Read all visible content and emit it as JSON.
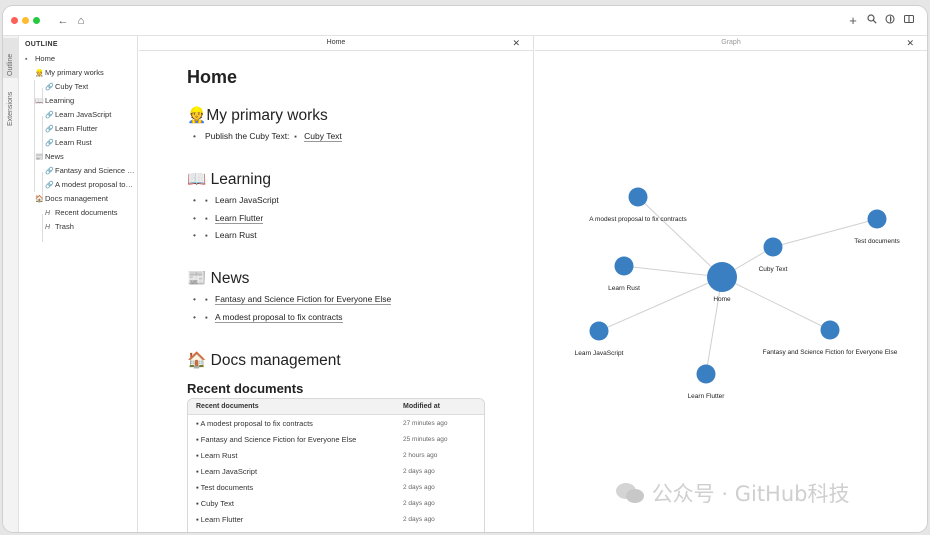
{
  "titlebar": {
    "colors": {
      "close": "#fe5f57",
      "minimize": "#febc2e",
      "zoom": "#28c840"
    },
    "icons": [
      "back-icon",
      "home-icon",
      "plus-icon",
      "search-icon",
      "globe-icon",
      "split-view-icon"
    ]
  },
  "vertical_tabs": {
    "outline": "Outline",
    "extensions": "Extensions"
  },
  "outline": {
    "title": "OUTLINE",
    "items": [
      {
        "label": "Home",
        "icon": "doc-icon"
      },
      {
        "label": "My primary works",
        "icon": "worker-emoji"
      },
      {
        "label": "Cuby Text",
        "icon": "link-icon"
      },
      {
        "label": "Learning",
        "icon": "book-emoji"
      },
      {
        "label": "Learn JavaScript",
        "icon": "link-icon"
      },
      {
        "label": "Learn Flutter",
        "icon": "link-icon"
      },
      {
        "label": "Learn Rust",
        "icon": "link-icon"
      },
      {
        "label": "News",
        "icon": "newspaper-emoji"
      },
      {
        "label": "Fantasy and Science Fiction for Everyone Else",
        "icon": "link-icon"
      },
      {
        "label": "A modest proposal to fix contracts",
        "icon": "link-icon"
      },
      {
        "label": "Docs management",
        "icon": "house-emoji"
      },
      {
        "label": "Recent documents",
        "icon": "heading-icon"
      },
      {
        "label": "Trash",
        "icon": "heading-icon"
      }
    ]
  },
  "home_pane": {
    "tab_title": "Home",
    "title": "Home",
    "sections": {
      "works": {
        "heading": "My primary works",
        "emoji": "👷",
        "item_prefix": "Publish the Cuby Text:",
        "item_link": "Cuby Text"
      },
      "learning": {
        "heading": "Learning",
        "emoji": "📖",
        "items": [
          "Learn JavaScript",
          "Learn Flutter",
          "Learn Rust"
        ]
      },
      "news": {
        "heading": "News",
        "emoji": "📰",
        "items": [
          "Fantasy and Science Fiction for Everyone Else",
          "A modest proposal to fix contracts"
        ]
      },
      "docs": {
        "heading": "Docs management",
        "emoji": "🏠",
        "subheading": "Recent documents"
      }
    },
    "table": {
      "headers": [
        "Recent documents",
        "Modified at"
      ],
      "rows": [
        [
          "A modest proposal to fix contracts",
          "27 minutes ago"
        ],
        [
          "Fantasy and Science Fiction for Everyone Else",
          "25 minutes ago"
        ],
        [
          "Learn Rust",
          "2 hours ago"
        ],
        [
          "Learn JavaScript",
          "2 days ago"
        ],
        [
          "Test documents",
          "2 days ago"
        ],
        [
          "Cuby Text",
          "2 days ago"
        ],
        [
          "Learn Flutter",
          "2 days ago"
        ]
      ]
    }
  },
  "graph_pane": {
    "tab_title": "Graph",
    "node_color": "#3a7fc2",
    "nodes": {
      "home": "Home",
      "proposal": "A modest proposal to fix contracts",
      "test": "Test documents",
      "cuby": "Cuby Text",
      "rust": "Learn Rust",
      "js": "Learn JavaScript",
      "fantasy": "Fantasy and Science Fiction for Everyone Else",
      "flutter": "Learn Flutter"
    }
  },
  "watermark": "公众号 · GitHub科技"
}
